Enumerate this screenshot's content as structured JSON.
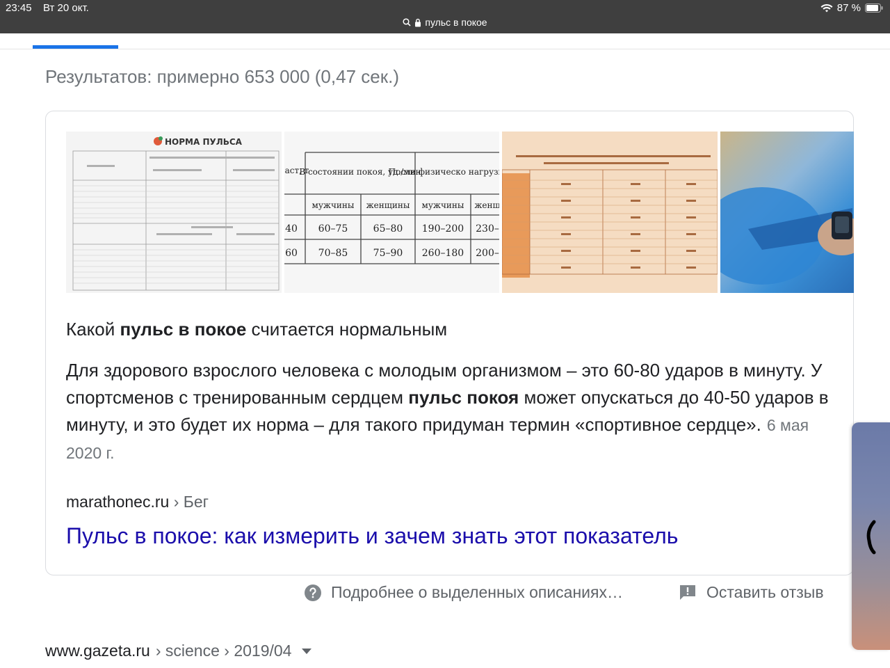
{
  "status_bar": {
    "time": "23:45",
    "date": "Вт 20 окт.",
    "battery": "87 %"
  },
  "address_bar": {
    "query": "пульс в покое"
  },
  "results": {
    "stats": "Результатов: примерно 653 000 (0,47 сек.)"
  },
  "featured_snippet": {
    "title_pre": "Какой ",
    "title_bold": "пульс в покое",
    "title_post": " считается нормальным",
    "body_part1": "Для здорового взрослого человека с молодым организмом – это 60-80 ударов в минуту. У спортсменов с тренированным сердцем ",
    "body_bold": "пульс покоя",
    "body_part2": " может опускаться до 40-50 ударов в минуту, и это будет их норма – для такого придуман термин «спортивное сердце».",
    "date": "6 мая 2020 г.",
    "source_domain": "marathonec.ru",
    "source_breadcrumb": "› Бег",
    "link_title": "Пульс в покое: как измерить и зачем знать этот показатель",
    "images": [
      {
        "kind": "table-image",
        "title": "НОРМА ПУЛЬСА"
      },
      {
        "kind": "table-image",
        "header_1": "В состоянии покоя, уд./мин",
        "header_2": "После физическо нагрузки, уд./ми",
        "sub": [
          "мужчины",
          "женщины",
          "мужчины",
          "женщ"
        ],
        "rows": [
          [
            "40",
            "60–75",
            "65–80",
            "190–200",
            "230–"
          ],
          [
            "60",
            "70–85",
            "75–90",
            "260–180",
            "200–"
          ]
        ],
        "cut_header": "аст, т"
      },
      {
        "kind": "table-image"
      },
      {
        "kind": "photo"
      }
    ]
  },
  "footer": {
    "about_label": "Подробнее о выделенных описаниях…",
    "feedback_label": "Оставить отзыв"
  },
  "next_result": {
    "domain": "www.gazeta.ru",
    "breadcrumb": "› science › 2019/04"
  },
  "colors": {
    "link": "#1a0dab",
    "tab_accent": "#1a73e8",
    "muted_text": "#70757a"
  }
}
